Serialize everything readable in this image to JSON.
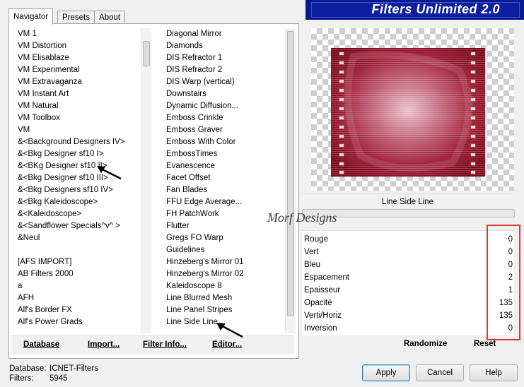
{
  "title": "Filters Unlimited 2.0",
  "tabs": [
    {
      "label": "Navigator",
      "active": true
    },
    {
      "label": "Presets",
      "active": false
    },
    {
      "label": "About",
      "active": false
    }
  ],
  "categories": [
    "VM 1",
    "VM Distortion",
    "VM Elisablaze",
    "VM Experimental",
    "VM Extravaganza",
    "VM Instant Art",
    "VM Natural",
    "VM Toolbox",
    "VM",
    "&<Background Designers IV>",
    "&<Bkg Designer sf10 I>",
    "&<BKg Designer sf10 II>",
    "&<Bkg Designer sf10 III>",
    "&<Bkg Designers sf10 IV>",
    "&<Bkg Kaleidoscope>",
    "&<Kaleidoscope>",
    "&<Sandflower Specials^v^ >",
    "&Neul",
    "",
    "[AFS IMPORT]",
    "AB Filters 2000",
    "a",
    "AFH",
    "Alf's Border FX",
    "Alf's Power Grads"
  ],
  "filters": [
    {
      "label": "Diagonal Mirror",
      "grip": false
    },
    {
      "label": "Diamonds",
      "grip": false
    },
    {
      "label": "DIS Refractor 1",
      "grip": false
    },
    {
      "label": "DIS Refractor 2",
      "grip": true
    },
    {
      "label": "DIS Warp (vertical)",
      "grip": false
    },
    {
      "label": "Downstairs",
      "grip": false
    },
    {
      "label": "Dynamic Diffusion...",
      "grip": false
    },
    {
      "label": "Emboss Crinkle",
      "grip": false
    },
    {
      "label": "Emboss Graver",
      "grip": false
    },
    {
      "label": "Emboss With Color",
      "grip": false
    },
    {
      "label": "EmbossTimes",
      "grip": false
    },
    {
      "label": "Evanescence",
      "grip": false
    },
    {
      "label": "Facet Offset",
      "grip": false
    },
    {
      "label": "Fan Blades",
      "grip": false
    },
    {
      "label": "FFU Edge Average...",
      "grip": false
    },
    {
      "label": "FH PatchWork",
      "grip": false
    },
    {
      "label": "Flutter",
      "grip": true
    },
    {
      "label": "Gregs FO Warp",
      "grip": false
    },
    {
      "label": "Guidelines",
      "grip": true
    },
    {
      "label": "Hinzeberg's Mirror 01",
      "grip": false
    },
    {
      "label": "Hinzeberg's Mirror 02",
      "grip": false
    },
    {
      "label": "Kaleidoscope 8",
      "grip": false
    },
    {
      "label": "Line Blurred Mesh",
      "grip": false
    },
    {
      "label": "Line Panel Stripes",
      "grip": false
    },
    {
      "label": "Line Side Line",
      "grip": false
    }
  ],
  "toolbar": {
    "database": "Database",
    "import": "Import...",
    "filter_info": "Filter Info...",
    "editor": "Editor..."
  },
  "selected_filter": "Line Side Line",
  "watermark": "Morf Designs",
  "params": [
    {
      "label": "Rouge",
      "value": "0"
    },
    {
      "label": "Vert",
      "value": "0"
    },
    {
      "label": "Bleu",
      "value": "0"
    },
    {
      "label": "Espacement",
      "value": "2"
    },
    {
      "label": "Epaisseur",
      "value": "1"
    },
    {
      "label": "Opacité",
      "value": "135"
    },
    {
      "label": "Verti/Horiz",
      "value": "135"
    },
    {
      "label": "Inversion",
      "value": "0"
    }
  ],
  "actions": {
    "randomize": "Randomize",
    "reset": "Reset"
  },
  "status": {
    "database_label": "Database:",
    "database_value": "ICNET-Filters",
    "filters_label": "Filters:",
    "filters_value": "5945"
  },
  "buttons": {
    "apply": "Apply",
    "cancel": "Cancel",
    "help": "Help"
  },
  "colors": {
    "banner": "#0a1a8c",
    "preview_red": "#8c0f22",
    "highlight_box": "#e53535"
  }
}
